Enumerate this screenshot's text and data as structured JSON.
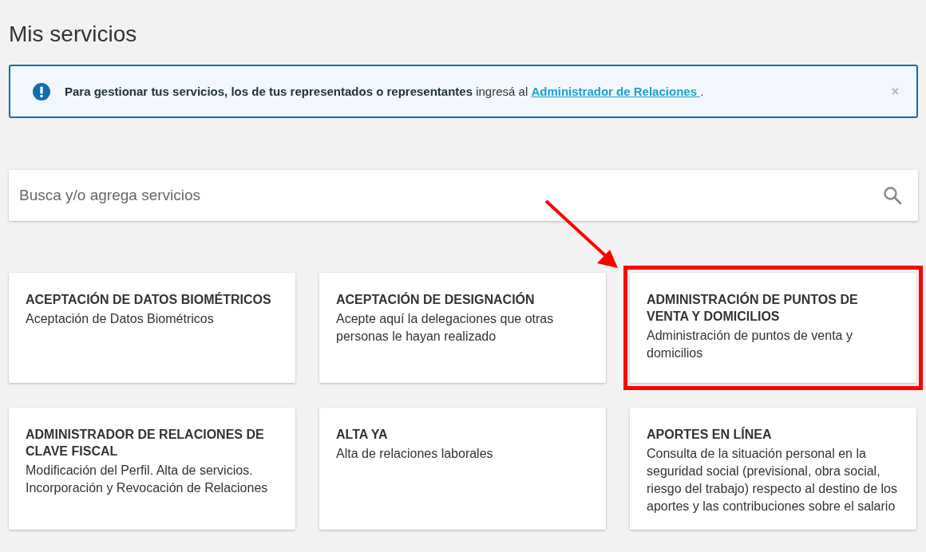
{
  "page_title": "Mis servicios",
  "alert": {
    "text": "**Para gestionar tus servicios, los de tus representados o representantes** ingresá al",
    "link": "Administrador de Relaciones ",
    "after": ".",
    "close": "×"
  },
  "search": {
    "placeholder": "Busca y/o agrega servicios"
  },
  "cards": [
    {
      "title": "ACEPTACIÓN DE DATOS BIOMÉTRICOS",
      "description": "Aceptación de Datos Biométricos",
      "highlighted": false
    },
    {
      "title": "ACEPTACIÓN DE DESIGNACIÓN",
      "description": "Acepte aquí la delegaciones que otras personas le hayan realizado",
      "highlighted": false
    },
    {
      "title": "ADMINISTRACIÓN DE PUNTOS DE VENTA Y DOMICILIOS",
      "description": "Administración de puntos de venta y domicilios",
      "highlighted": true
    },
    {
      "title": "ADMINISTRADOR DE RELACIONES DE CLAVE FISCAL",
      "description": "Modificación del Perfil. Alta de servicios. Incorporación y Revocación de Relaciones",
      "highlighted": false
    },
    {
      "title": "ALTA YA",
      "description": "Alta de relaciones laborales",
      "highlighted": false
    },
    {
      "title": "APORTES EN LÍNEA",
      "description": "Consulta de la situación personal en la seguridad social (previsional, obra social, riesgo del trabajo) respecto al destino de los aportes y las contribuciones sobre el salario",
      "highlighted": false
    }
  ]
}
